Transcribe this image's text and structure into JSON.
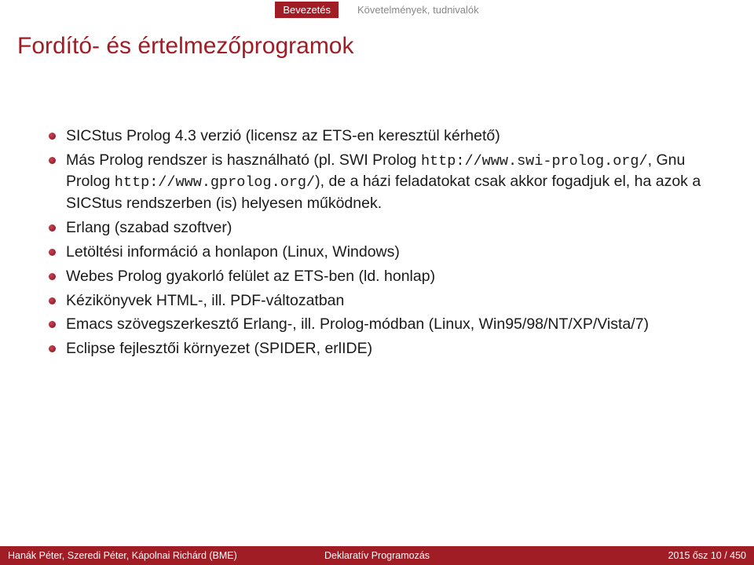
{
  "nav": {
    "left": "Bevezetés",
    "right": "Követelmények, tudnivalók"
  },
  "title": "Fordító- és értelmezőprogramok",
  "bullets": [
    {
      "text": "SICStus Prolog 4.3 verzió (licensz az ETS-en keresztül kérhető)"
    },
    {
      "parts": [
        {
          "t": "Más Prolog rendszer is használható (pl. SWI Prolog "
        },
        {
          "t": "http://www.swi-prolog.org/",
          "mono": true
        },
        {
          "t": ", Gnu Prolog "
        },
        {
          "t": "http://www.gprolog.org/",
          "mono": true
        },
        {
          "t": "), de a házi feladatokat csak akkor fogadjuk el, ha azok a SICStus rendszerben (is) helyesen működnek."
        }
      ]
    },
    {
      "text": "Erlang (szabad szoftver)"
    },
    {
      "text": "Letöltési információ a honlapon (Linux, Windows)"
    },
    {
      "text": "Webes Prolog gyakorló felület az ETS-ben (ld. honlap)"
    },
    {
      "text": "Kézikönyvek HTML-, ill. PDF-változatban"
    },
    {
      "text": "Emacs szövegszerkesztő Erlang-, ill. Prolog-módban (Linux, Win95/98/NT/XP/Vista/7)"
    },
    {
      "text": "Eclipse fejlesztői környezet (SPIDER, erlIDE)"
    }
  ],
  "footer": {
    "authors": "Hanák Péter, Szeredi Péter, Kápolnai Richárd (BME)",
    "course": "Deklaratív Programozás",
    "page": "2015 ősz      10 / 450"
  }
}
